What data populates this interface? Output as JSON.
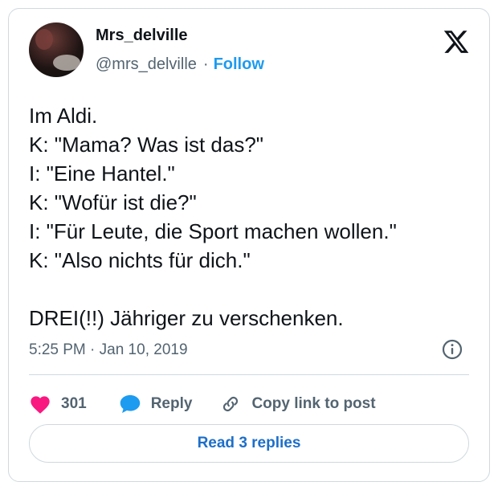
{
  "author": {
    "display_name": "Mrs_delville",
    "handle": "@mrs_delville",
    "separator": "·",
    "follow_label": "Follow"
  },
  "tweet": {
    "text": "Im Aldi.\nK: \"Mama? Was ist das?\"\nI: \"Eine Hantel.\"\nK: \"Wofür ist die?\"\nI: \"Für Leute, die Sport machen wollen.\"\nK: \"Also nichts für dich.\"\n\nDREI(!!) Jähriger zu verschenken.",
    "timestamp": "5:25 PM · Jan 10, 2019"
  },
  "actions": {
    "like_count": "301",
    "reply_label": "Reply",
    "copy_link_label": "Copy link to post"
  },
  "footer": {
    "read_replies_label": "Read 3 replies"
  },
  "colors": {
    "accent": "#1d9bf0",
    "like": "#f91880",
    "text": "#0f1419",
    "muted": "#536471",
    "border": "#cfd9de"
  },
  "icons": {
    "logo": "x-logo-icon",
    "info": "info-icon",
    "like": "heart-icon",
    "reply": "speech-bubble-icon",
    "copy": "link-icon"
  }
}
